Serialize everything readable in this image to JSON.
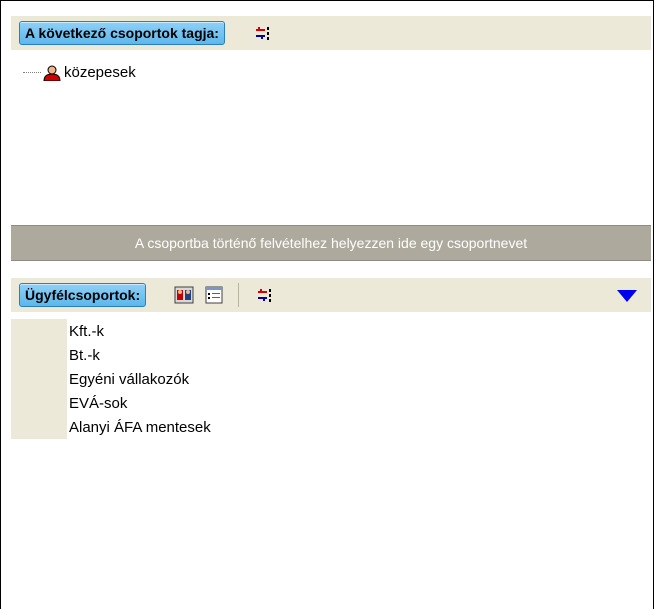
{
  "member_panel": {
    "title": "A következő csoportok tagja:",
    "groups": [
      "közepesek"
    ]
  },
  "drop_hint": "A csoportba történő felvételhez helyezzen ide egy csoportnevet",
  "client_groups": {
    "title": "Ügyfélcsoportok:",
    "items": [
      "Kft.-k",
      "Bt.-k",
      "Egyéni vállakozók",
      "EVÁ-sok",
      "Alanyi ÁFA mentesek"
    ]
  },
  "icons": {
    "sort": "sort-icon",
    "group_card": "group-card-icon",
    "list_view": "list-view-icon",
    "user": "user-icon",
    "expand": "expand-down-icon"
  },
  "colors": {
    "header_button": "#6ec3f2",
    "toolbar_bg": "#ece9d8",
    "drop_bar_bg": "#ada99d",
    "expand_arrow": "#0000ee"
  }
}
